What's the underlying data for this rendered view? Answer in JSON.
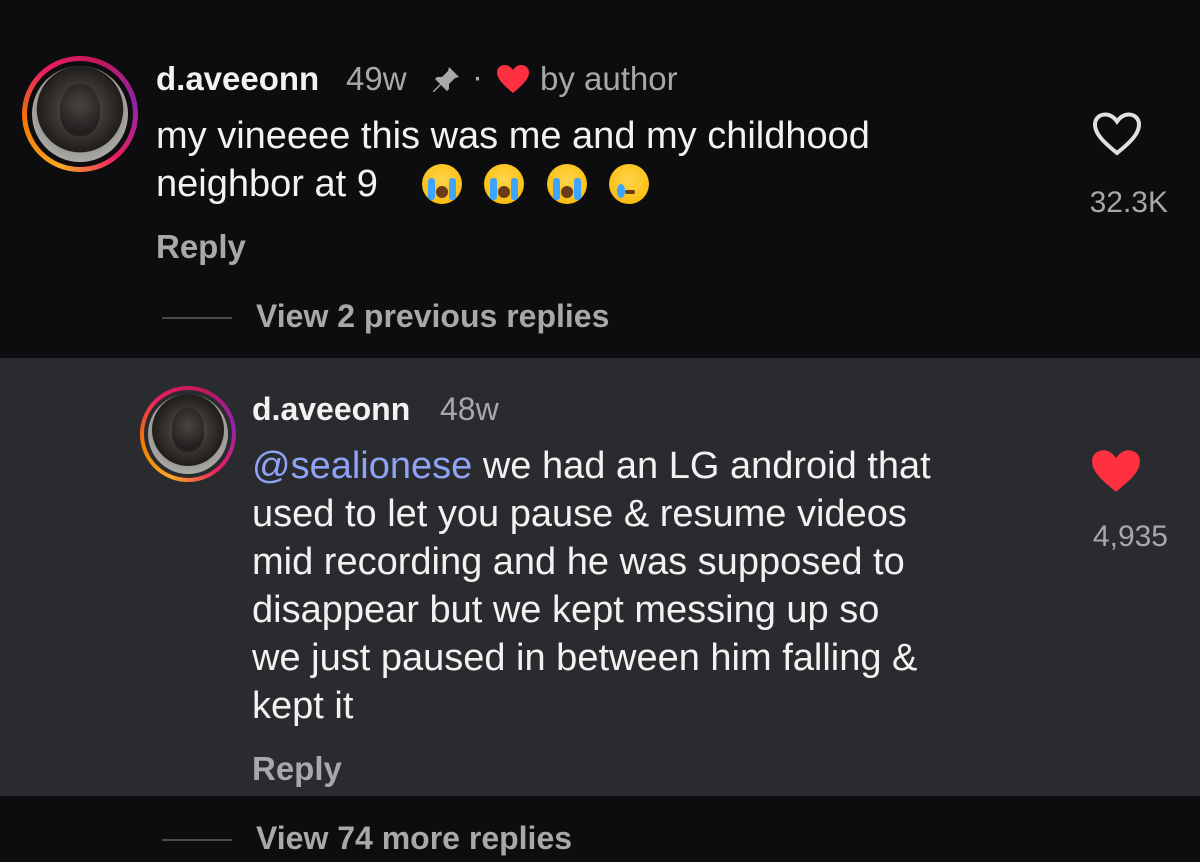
{
  "comment": {
    "username": "d.aveeonn",
    "age": "49w",
    "separator": "·",
    "liked_by": "by author",
    "text": "my vineeee this was me and my childhood neighbor at 9",
    "emojis": [
      "loudly-crying-face",
      "loudly-crying-face",
      "loudly-crying-face",
      "face-holding-back-tears"
    ],
    "reply_label": "Reply",
    "like_count": "32.3K",
    "icons": {
      "pin": "pin-icon",
      "author_heart": "heart-icon",
      "like": "heart-outline-icon"
    }
  },
  "view_previous": "View 2 previous replies",
  "reply": {
    "username": "d.aveeonn",
    "age": "48w",
    "mention": "@sealionese",
    "text_line1": " we had an LG android that",
    "text_line2": "used to let you pause & resume videos",
    "text_line3": "mid recording and he was supposed to",
    "text_line4": "disappear but we kept messing up so",
    "text_line5": "we just paused in between him falling &",
    "text_line6": "kept it",
    "reply_label": "Reply",
    "like_count": "4,935",
    "liked": true
  },
  "view_more": "View 74 more replies",
  "colors": {
    "accent_mention": "#8fa2f5",
    "heart_red": "#ff3040",
    "reply_bg": "#2a2b2e",
    "bg": "#0d0d0f"
  }
}
